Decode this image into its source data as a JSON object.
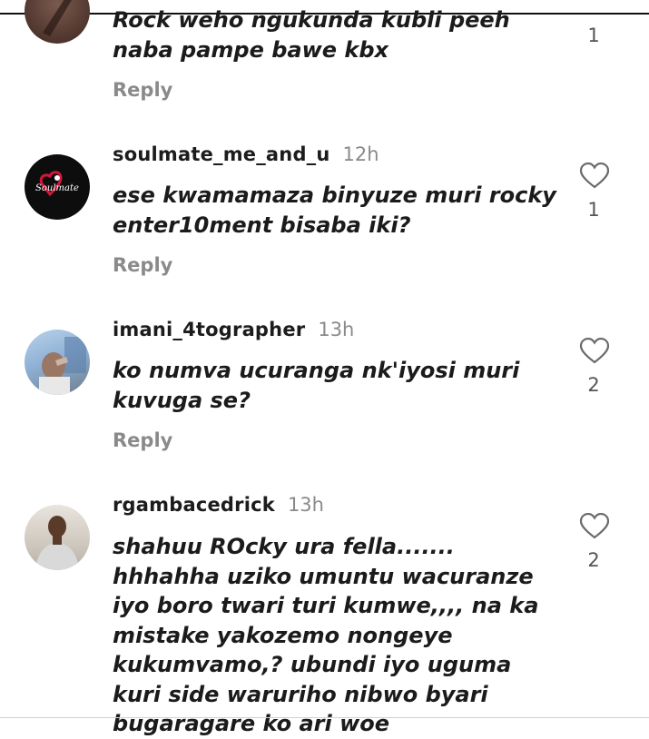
{
  "comments": [
    {
      "username": "",
      "time": "",
      "text": "Rock weho ngukunda kubli peeh naba pampe bawe kbx",
      "reply_label": "Reply",
      "likes": "1",
      "avatar_icon": "user-avatar"
    },
    {
      "username": "soulmate_me_and_u",
      "time": "12h",
      "text": "ese kwamamaza  binyuze muri rocky enter10ment bisaba iki?",
      "reply_label": "Reply",
      "likes": "1",
      "avatar_icon": "soulmate-logo",
      "avatar_logo_text": "Soulmate"
    },
    {
      "username": "imani_4tographer",
      "time": "13h",
      "text": "ko numva ucuranga nk'iyosi muri kuvuga se?",
      "reply_label": "Reply",
      "likes": "2",
      "avatar_icon": "user-avatar"
    },
    {
      "username": "rgambacedrick",
      "time": "13h",
      "text": "shahuu ROcky ura fella....... hhhahha uziko umuntu wacuranze iyo boro twari turi kumwe,,,, na ka mistake yakozemo nongeye kukumvamo,? ubundi iyo uguma kuri side waruriho nibwo byari bugaragare ko ari woe",
      "reply_label": "Reply",
      "likes": "2",
      "avatar_icon": "user-avatar"
    }
  ],
  "colors": {
    "text": "#1b1b1b",
    "muted": "#8a8a8a",
    "heart_stroke": "#6b6b6b"
  },
  "icons": {
    "like": "heart-outline-icon"
  }
}
